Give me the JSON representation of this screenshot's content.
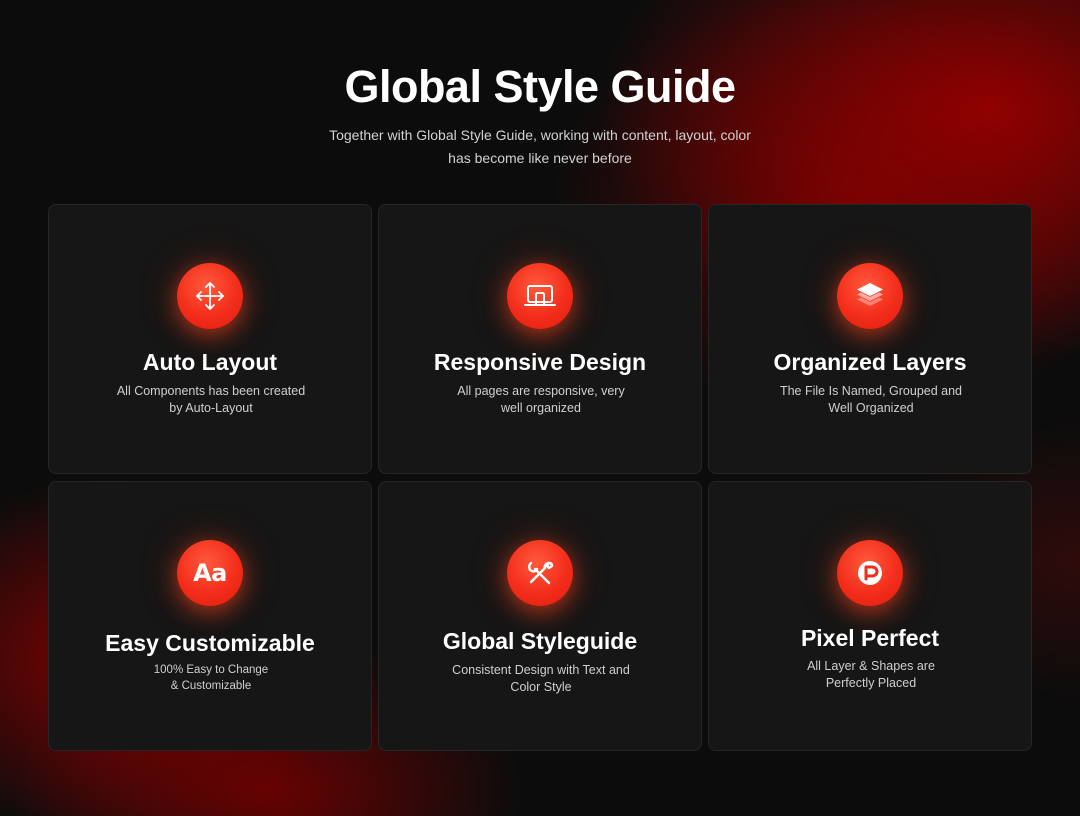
{
  "header": {
    "title": "Global Style Guide",
    "subtitle_line1": "Together with Global Style Guide, working with content, layout, color",
    "subtitle_line2": "has become like never before"
  },
  "colors": {
    "accent": "#f32d1a",
    "background": "#0c0c0c",
    "card": "#161616",
    "glow_red": "#960000"
  },
  "cards": [
    {
      "icon": "move-arrows-icon",
      "title": "Auto Layout",
      "desc_line1": "All Components has been created",
      "desc_line2": "by Auto-Layout"
    },
    {
      "icon": "laptop-icon",
      "title": "Responsive Design",
      "desc_line1": "All pages are responsive, very",
      "desc_line2": "well organized"
    },
    {
      "icon": "layers-icon",
      "title": "Organized Layers",
      "desc_line1": "The File Is Named, Grouped and",
      "desc_line2": "Well Organized"
    },
    {
      "icon": "typography-icon",
      "icon_text": "Aa",
      "title": "Easy Customizable",
      "desc_line1": "100% Easy to Change",
      "desc_line2": "& Customizable"
    },
    {
      "icon": "tools-icon",
      "title": "Global Styleguide",
      "desc_line1": "Consistent Design with Text and",
      "desc_line2": "Color Style"
    },
    {
      "icon": "pixel-pen-icon",
      "title": "Pixel Perfect",
      "desc_line1": "All Layer & Shapes are",
      "desc_line2": "Perfectly Placed"
    }
  ]
}
